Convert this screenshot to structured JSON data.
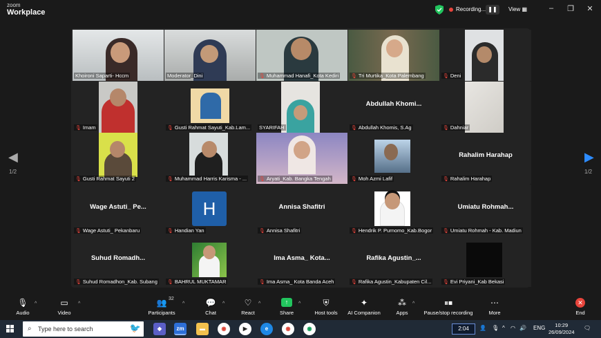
{
  "app": {
    "brand_small": "zoom",
    "brand_big": "Workplace"
  },
  "titlebar": {
    "recording_label": "Recording...",
    "view_label": "View"
  },
  "pager": {
    "left": "1/2",
    "right": "1/2"
  },
  "participants": [
    {
      "name": "Khoironi Saparti- Hccm",
      "muted": false,
      "video": true
    },
    {
      "name": "Moderator_Dini",
      "muted": false,
      "video": true,
      "active": true
    },
    {
      "name": "Muhammad Hanafi_Kota Kediri",
      "muted": true,
      "video": true
    },
    {
      "name": "Tri Murtika_Kota Palembang",
      "muted": true,
      "video": true
    },
    {
      "name": "Deni",
      "muted": true,
      "video": true
    },
    {
      "name": "Imam",
      "muted": true,
      "video": true
    },
    {
      "name": "Gusti Rahmat Sayuti_Kab.Lam...",
      "muted": true,
      "video": true
    },
    {
      "name": "SYARIFAH",
      "muted": false,
      "video": true
    },
    {
      "name": "Abdullah Khomis, S.Ag",
      "display": "Abdullah  Khomi...",
      "muted": true,
      "video": false
    },
    {
      "name": "Dahniar",
      "muted": true,
      "video": true
    },
    {
      "name": "Gusti Rahmat Sayuti 2",
      "muted": true,
      "video": true
    },
    {
      "name": "Muhammad Harris Karisma - ...",
      "muted": true,
      "video": true
    },
    {
      "name": "Aryati_Kab. Bangka Tengah",
      "muted": true,
      "video": true
    },
    {
      "name": "Moh Azmi Lafif",
      "muted": true,
      "video": true
    },
    {
      "name": "Rahalim Harahap",
      "display": "Rahalim Harahap",
      "muted": true,
      "video": false
    },
    {
      "name": "Wage Astuti_ Pekanbaru",
      "display": "Wage  Astuti_  Pe...",
      "muted": true,
      "video": false
    },
    {
      "name": "Handian Yan",
      "display": "H",
      "muted": true,
      "video": false,
      "avatar": true
    },
    {
      "name": "Annisa Shafitri",
      "display": "Annisa Shafitri",
      "muted": true,
      "video": false
    },
    {
      "name": "Hendrik P. Purnomo_Kab.Bogor",
      "muted": true,
      "video": true
    },
    {
      "name": "Umiatu Rohmah - Kab. Madiun",
      "display": "Umiatu  Rohmah...",
      "muted": true,
      "video": false
    },
    {
      "name": "Suhud Romadhon_Kab. Subang",
      "display": "Suhud  Romadh...",
      "muted": true,
      "video": false
    },
    {
      "name": "BAHRUL MUKTAMAR",
      "muted": true,
      "video": true
    },
    {
      "name": "Ima Asma_ Kota Banda Aceh",
      "display": "Ima  Asma_  Kota...",
      "muted": true,
      "video": false
    },
    {
      "name": "Rafika Agustin_Kabupaten Cil...",
      "display": "Rafika  Agustin_...",
      "muted": true,
      "video": false
    },
    {
      "name": "Evi Priyani_Kab Bekasi",
      "muted": true,
      "video": true
    }
  ],
  "toolbar": {
    "audio": "Audio",
    "video": "Video",
    "participants": "Participants",
    "participants_count": "32",
    "chat": "Chat",
    "react": "React",
    "share": "Share",
    "host_tools": "Host tools",
    "ai_companion": "AI Companion",
    "apps": "Apps",
    "record": "Pause/stop recording",
    "more": "More",
    "end": "End"
  },
  "taskbar": {
    "search_placeholder": "Type here to search",
    "timer": "2:04",
    "lang": "ENG",
    "time": "10:29",
    "date": "26/09/2024"
  }
}
